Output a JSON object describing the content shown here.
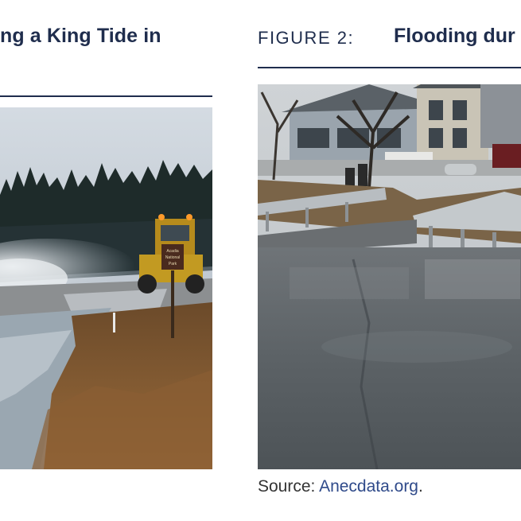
{
  "left_figure": {
    "title": "ng a King Tide in"
  },
  "right_figure": {
    "label": "FIGURE 2:",
    "title": "Flooding dur",
    "source_prefix": "Source: ",
    "source_link": "Anecdata.org",
    "source_suffix": "."
  },
  "left_photo": {
    "sign_text_1": "Acadia",
    "sign_text_2": "National",
    "sign_text_3": "Park"
  }
}
